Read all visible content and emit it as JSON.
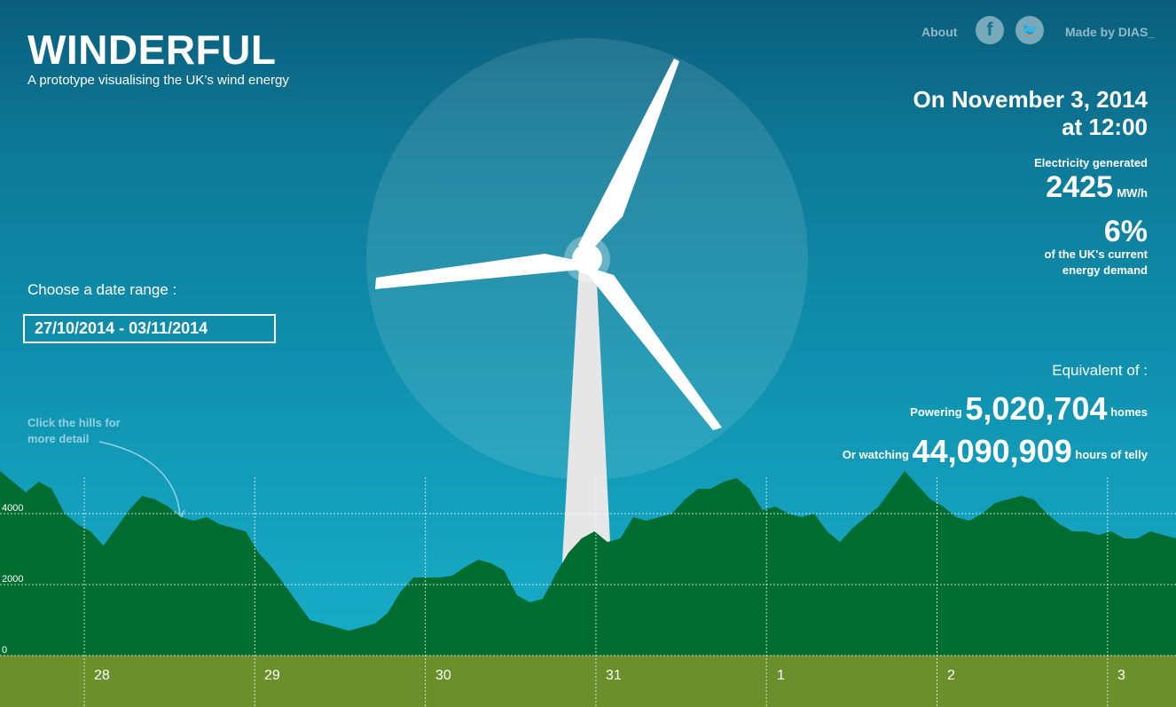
{
  "header": {
    "logo": "WINDERFUL",
    "subtitle": "A prototype visualising the UK’s wind energy",
    "nav_about": "About",
    "nav_made_by": "Made by DIAS_",
    "facebook_glyph": "f",
    "twitter_glyph": "🐦"
  },
  "summary": {
    "date_line1": "On November 3, 2014",
    "date_line2": "at 12:00",
    "electricity_label": "Electricity generated",
    "electricity_value": "2425",
    "electricity_unit": "MW/h",
    "percent_value": "6%",
    "percent_label_line1": "of the UK's current",
    "percent_label_line2": "energy demand"
  },
  "equivalent": {
    "title": "Equivalent of :",
    "homes_prefix": "Powering",
    "homes_value": "5,020,704",
    "homes_suffix": "homes",
    "telly_prefix": "Or watching",
    "telly_value": "44,090,909",
    "telly_suffix": "hours of telly"
  },
  "controls": {
    "range_label": "Choose a date range :",
    "range_value": "27/10/2014 - 03/11/2014",
    "hint": "Click the hills for more detail"
  },
  "colors": {
    "hills": "#006d30",
    "ground": "#6a8f2b",
    "gridline": "#ffffff"
  },
  "chart_data": {
    "type": "area",
    "y_ticks": [
      "4000",
      "2000",
      "0"
    ],
    "ylim": [
      0,
      5500
    ],
    "x_day_labels": [
      "28",
      "29",
      "30",
      "31",
      "1",
      "2",
      "3"
    ],
    "series": [
      {
        "values": [
          5200,
          4900,
          4600,
          4900,
          4700,
          4000,
          3700,
          3500,
          3100,
          3600,
          4100,
          4500,
          4400,
          4200,
          3900,
          3800,
          3900,
          3700,
          3600,
          3500,
          2900,
          2500,
          2000,
          1500,
          1000,
          900,
          800,
          700,
          800,
          900,
          1200,
          1800,
          2200,
          2200,
          2200,
          2250,
          2500,
          2700,
          2600,
          2400,
          1700,
          1500,
          1600,
          2300,
          2900,
          3300,
          3500,
          3200,
          3300,
          3900,
          3800,
          3900,
          4000,
          4400,
          4700,
          4700,
          4900,
          5000,
          4700,
          4100,
          4200,
          4000,
          3900,
          4000,
          3500,
          3200,
          3600,
          3900,
          4200,
          4700,
          5200,
          4800,
          4400,
          4200,
          3900,
          3800,
          4000,
          4300,
          4400,
          4500,
          4400,
          4000,
          3700,
          3500,
          3500,
          3400,
          3500,
          3300,
          3300,
          3500,
          3400,
          3300
        ]
      }
    ]
  }
}
